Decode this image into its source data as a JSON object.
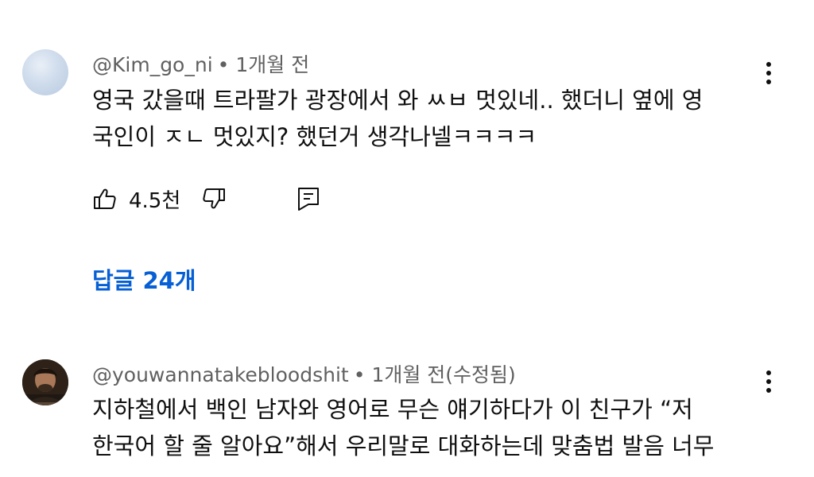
{
  "comments": [
    {
      "author": "@Kim_go_ni",
      "separator": "•",
      "time": "1개월 전",
      "lines": [
        "영국 갔을때 트라팔가 광장에서 와 ㅆㅂ 멋있네.. 했더니 옆에 영",
        "국인이 ㅈㄴ 멋있지? 했던거 생각나넬ㅋㅋㅋㅋ"
      ],
      "likes": "4.5천",
      "replies": "답글 24개",
      "avatar_icon": "avatar-sky-icon"
    },
    {
      "author": "@youwannatakebloodshit",
      "separator": "•",
      "time": "1개월 전(수정됨)",
      "lines": [
        "지하철에서 백인 남자와 영어로 무슨 얘기하다가 이 친구가 “저",
        "한국어 할 줄 알아요”해서 우리말로 대화하는데 맞춤법 발음 너무"
      ],
      "avatar_icon": "avatar-portrait-icon"
    }
  ],
  "colors": {
    "text": "#0f0f0f",
    "meta": "#606060",
    "link": "#065fd4",
    "background": "#ffffff"
  }
}
